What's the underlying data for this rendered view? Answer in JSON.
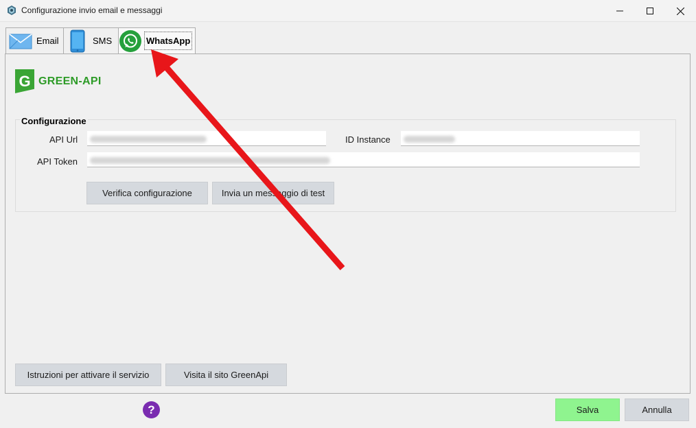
{
  "window": {
    "title": "Configurazione invio email e messaggi",
    "controls": [
      "minimize-icon",
      "maximize-icon",
      "close-icon"
    ]
  },
  "tabs": [
    {
      "label": "Email",
      "icon": "envelope-icon"
    },
    {
      "label": "SMS",
      "icon": "phone-icon"
    },
    {
      "label": "WhatsApp",
      "icon": "whatsapp-icon",
      "selected": true
    }
  ],
  "logo": {
    "brand": "GREEN-API",
    "letter": "G",
    "color": "#3aa535"
  },
  "config": {
    "group_title": "Configurazione",
    "api_url_label": "API Url",
    "api_url_value": "",
    "id_instance_label": "ID Instance",
    "id_instance_value": "",
    "api_token_label": "API Token",
    "api_token_value": ""
  },
  "buttons": {
    "verify": "Verifica configurazione",
    "send_test": "Invia un messaggio di test",
    "instructions": "Istruzioni per attivare il servizio",
    "visit_site": "Visita il sito GreenApi",
    "save": "Salva",
    "cancel": "Annulla"
  },
  "help": {
    "glyph": "?",
    "icon": "help-icon",
    "color": "#7a2cb0"
  },
  "colors": {
    "save": "#8ff48f",
    "button": "#d5d9de",
    "arrow": "#e8161a",
    "whatsapp": "#25a03c"
  }
}
